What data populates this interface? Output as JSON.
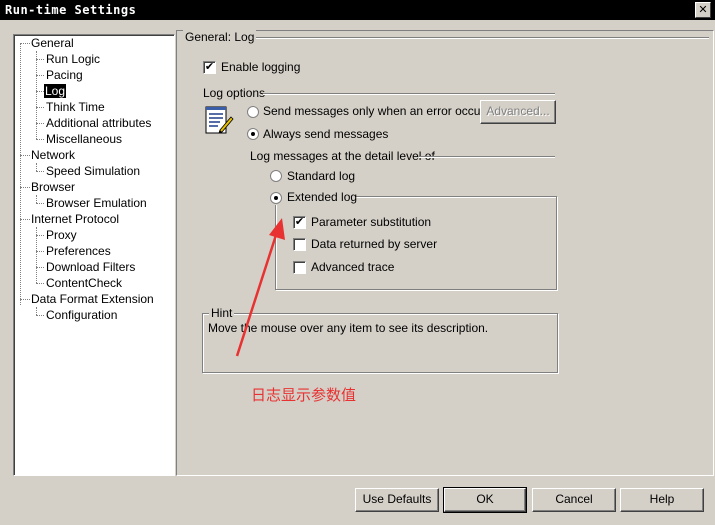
{
  "window": {
    "title": "Run-time Settings",
    "close": "✕"
  },
  "tree": {
    "items": [
      {
        "label": "General",
        "level": 0
      },
      {
        "label": "Run Logic",
        "level": 1
      },
      {
        "label": "Pacing",
        "level": 1
      },
      {
        "label": "Log",
        "level": 1,
        "selected": true
      },
      {
        "label": "Think Time",
        "level": 1
      },
      {
        "label": "Additional attributes",
        "level": 1
      },
      {
        "label": "Miscellaneous",
        "level": 1
      },
      {
        "label": "Network",
        "level": 0
      },
      {
        "label": "Speed Simulation",
        "level": 1
      },
      {
        "label": "Browser",
        "level": 0
      },
      {
        "label": "Browser Emulation",
        "level": 1
      },
      {
        "label": "Internet Protocol",
        "level": 0
      },
      {
        "label": "Proxy",
        "level": 1
      },
      {
        "label": "Preferences",
        "level": 1
      },
      {
        "label": "Download Filters",
        "level": 1
      },
      {
        "label": "ContentCheck",
        "level": 1
      },
      {
        "label": "Data Format Extension",
        "level": 0
      },
      {
        "label": "Configuration",
        "level": 1
      }
    ]
  },
  "panel": {
    "title": "General: Log",
    "enable_logging": {
      "label": "Enable logging",
      "checked": true
    },
    "log_options": {
      "title": "Log options",
      "send_error_only": {
        "label": "Send messages only when an error occurs",
        "selected": false
      },
      "advanced_button": "Advanced...",
      "always_send": {
        "label": "Always send messages",
        "selected": true
      },
      "detail_title": "Log messages at the detail level of",
      "standard_log": {
        "label": "Standard log",
        "selected": false
      },
      "extended_log": {
        "label": "Extended log",
        "selected": true
      },
      "parameter_substitution": {
        "label": "Parameter substitution",
        "checked": true
      },
      "data_returned": {
        "label": "Data returned by server",
        "checked": false
      },
      "advanced_trace": {
        "label": "Advanced trace",
        "checked": false
      }
    },
    "hint": {
      "title": "Hint",
      "text": "Move the mouse over any item to see its description."
    }
  },
  "annotation": {
    "text": "日志显示参数值",
    "color": "#e83232"
  },
  "buttons": {
    "use_defaults": "Use Defaults",
    "ok": "OK",
    "cancel": "Cancel",
    "help": "Help"
  },
  "colors": {
    "dialog": "#d4d0c8",
    "titlebar": "#000000",
    "selection": "#000000"
  },
  "check_mark": "✔"
}
